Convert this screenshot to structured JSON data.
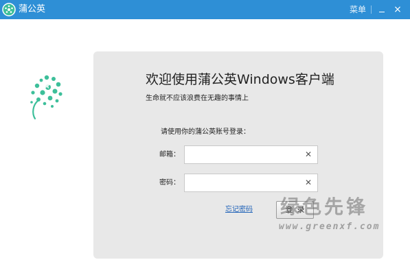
{
  "titlebar": {
    "app_title": "蒲公英",
    "menu_label": "菜单",
    "minimize_icon": "minimize-icon",
    "close_glyph": "×"
  },
  "colors": {
    "titlebar_bg": "#2e8fd6",
    "logo_green": "#3dbf9a",
    "panel_bg": "#e8e8e8",
    "link": "#1f62b8"
  },
  "main": {
    "heading": "欢迎使用蒲公英Windows客户端",
    "slogan": "生命就不应该浪费在无趣的事情上",
    "prompt": "请使用你的蒲公英账号登录：",
    "email": {
      "label": "邮箱：",
      "value": "",
      "placeholder": ""
    },
    "password": {
      "label": "密码：",
      "value": "",
      "placeholder": ""
    },
    "clear_glyph": "✕",
    "forgot_label": "忘记密码",
    "login_label": "登录"
  },
  "watermark": {
    "main": "绿色先锋",
    "sub": "www.greenxf.com"
  }
}
